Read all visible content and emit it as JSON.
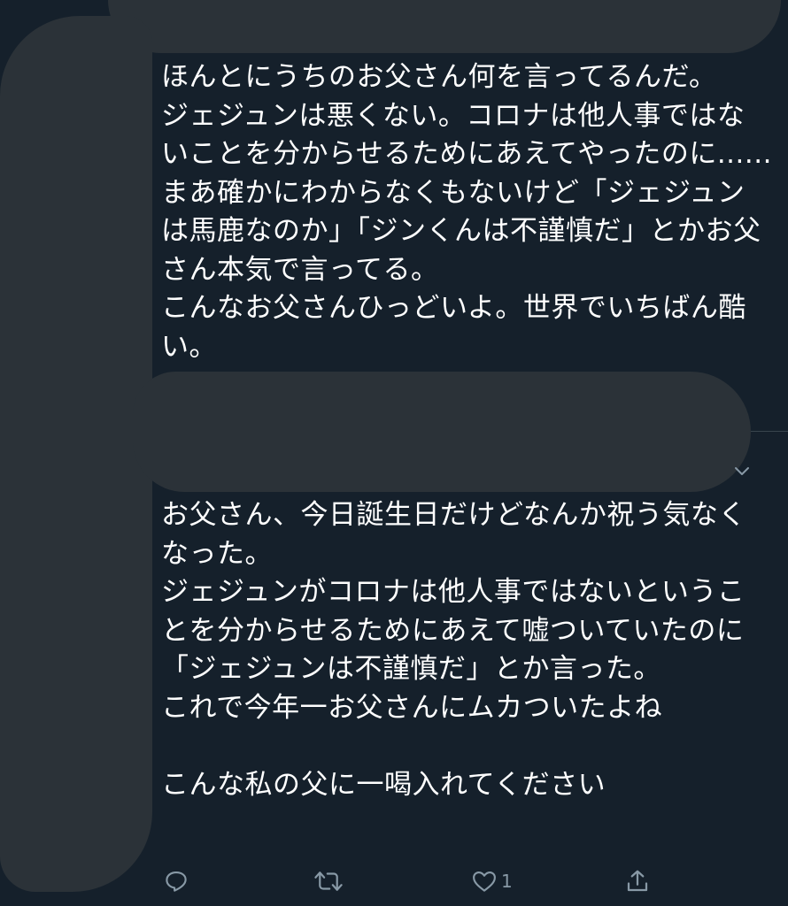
{
  "tweets": [
    {
      "text": "ほんとにうちのお父さん何を言ってるんだ。\nジェジュンは悪くない。コロナは他人事ではないことを分からせるためにあえてやったのに......まあ確かにわからなくもないけど「ジェジュンは馬鹿なのか」「ジンくんは不謹慎だ」とかお父さん本気で言ってる。\nこんなお父さんひっどいよ。世界でいちばん酷い。"
    },
    {
      "text": "お父さん、今日誕生日だけどなんか祝う気なくなった。\nジェジュンがコロナは他人事ではないということを分からせるためにあえて嘘ついていたのに\n「ジェジュンは不謹慎だ」とか言った。\nこれで今年一お父さんにムカついたよね\n\nこんな私の父に一喝入れてください",
      "actions": {
        "like_count": "1"
      }
    }
  ],
  "icons": {
    "menu": "chevron-down-icon",
    "reply": "reply-icon",
    "retweet": "retweet-icon",
    "like": "heart-icon",
    "share": "share-icon"
  },
  "colors": {
    "background": "#15202b",
    "text": "#ffffff",
    "icon": "#8899a6",
    "redaction": "#2b3238",
    "divider": "#38444d"
  }
}
